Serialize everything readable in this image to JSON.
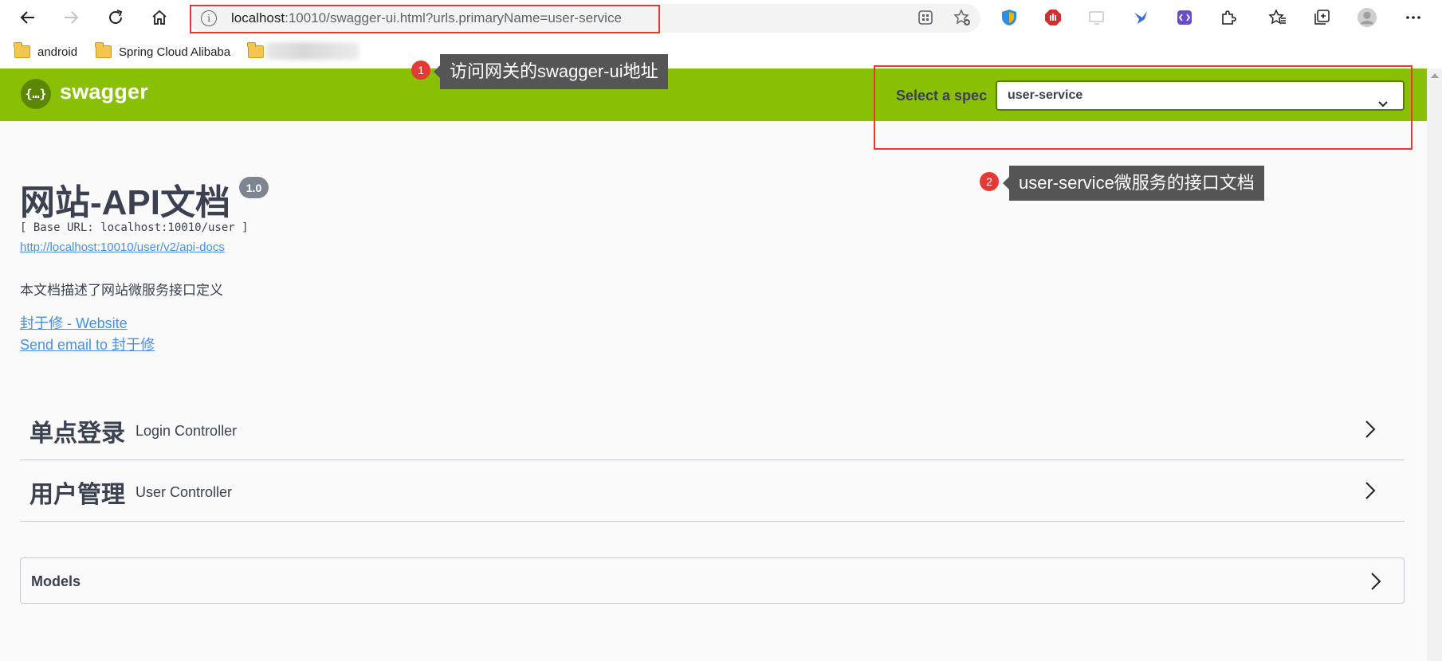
{
  "browser": {
    "url_host": "localhost",
    "url_rest": ":10010/swagger-ui.html?urls.primaryName=user-service",
    "info_glyph": "i",
    "bookmarks": [
      {
        "label": "android"
      },
      {
        "label": "Spring Cloud Alibaba"
      }
    ],
    "icons": [
      "back-icon",
      "forward-icon",
      "refresh-icon",
      "home-icon",
      "info-icon",
      "apps-icon",
      "favorite-add-icon",
      "extensions-icon",
      "favorites-icon",
      "collections-icon",
      "profile-icon",
      "more-icon"
    ]
  },
  "swagger": {
    "logo_glyph": "{…}",
    "brand": "swagger",
    "select_label": "Select a spec",
    "selected_spec": "user-service",
    "brand_color": "#89bf04"
  },
  "annotations": {
    "badge1": "1",
    "callout1": "访问网关的swagger-ui地址",
    "badge2": "2",
    "callout2": "user-service微服务的接口文档",
    "color": "#e53935"
  },
  "info": {
    "title": "网站-API文档",
    "version": "1.0",
    "base_url": "[ Base URL: localhost:10010/user ]",
    "docs_link": "http://localhost:10010/user/v2/api-docs",
    "description": "本文档描述了网站微服务接口定义",
    "website_link": "封于修 - Website",
    "email_link": "Send email to 封于修"
  },
  "tags": [
    {
      "name": "单点登录",
      "description": "Login Controller"
    },
    {
      "name": "用户管理",
      "description": "User Controller"
    }
  ],
  "models": {
    "title": "Models"
  }
}
